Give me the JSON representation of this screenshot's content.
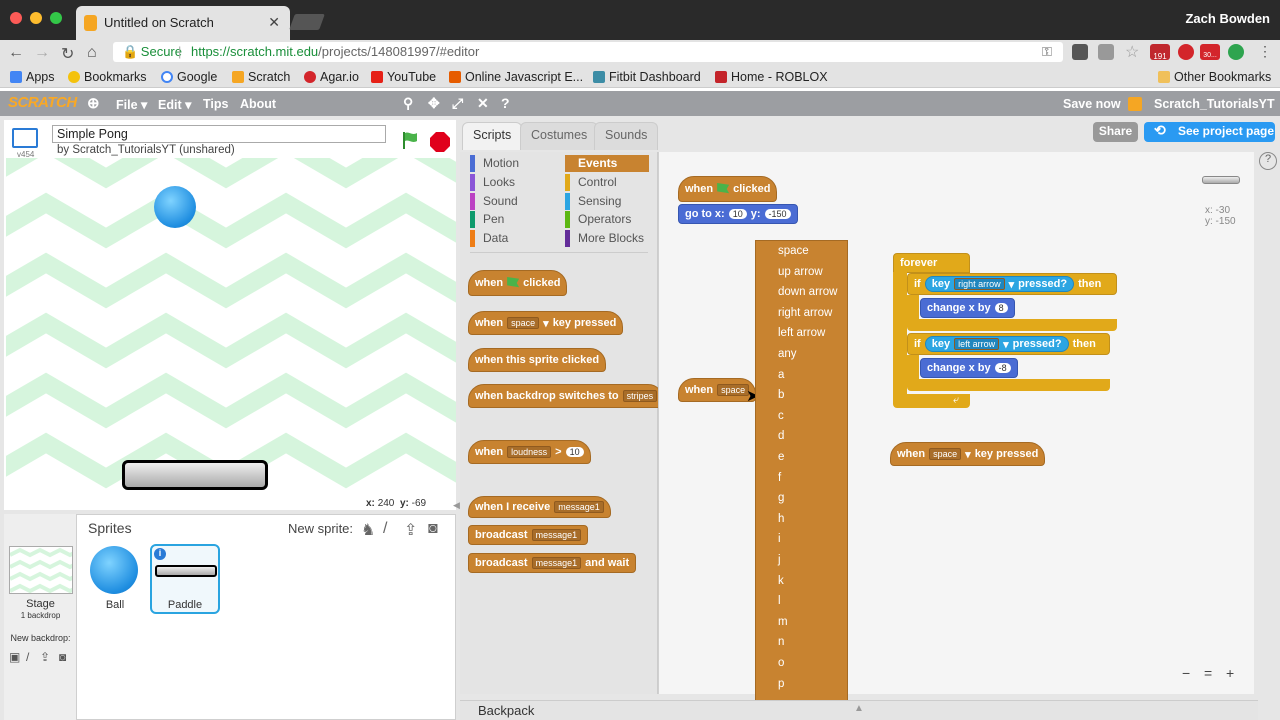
{
  "browser": {
    "tab_title": "Untitled on Scratch",
    "user": "Zach Bowden",
    "secure_label": "Secure",
    "url_host": "https://scratch.mit.edu",
    "url_path": "/projects/148081997/#editor",
    "bookmarks": [
      "Apps",
      "Bookmarks",
      "Google",
      "Scratch",
      "Agar.io",
      "YouTube",
      "Online Javascript E...",
      "Fitbit Dashboard",
      "Home - ROBLOX",
      "Other Bookmarks"
    ],
    "badge_count": "191",
    "badge_count2": "30..."
  },
  "menubar": {
    "logo": "SCRATCH",
    "file": "File ▾",
    "edit": "Edit ▾",
    "tips": "Tips",
    "about": "About",
    "save_now": "Save now",
    "account": "Scratch_TutorialsYT ▾"
  },
  "stage": {
    "version": "v454",
    "project_title": "Simple Pong",
    "by": "by Scratch_TutorialsYT (unshared)",
    "x_label": "x:",
    "x_value": "240",
    "y_label": "y:",
    "y_value": "-69"
  },
  "sprites": {
    "header": "Sprites",
    "new_sprite": "New sprite:",
    "stage_label": "Stage",
    "stage_sub": "1 backdrop",
    "new_backdrop": "New backdrop:",
    "items": [
      {
        "name": "Ball"
      },
      {
        "name": "Paddle"
      }
    ]
  },
  "tabs": {
    "scripts": "Scripts",
    "costumes": "Costumes",
    "sounds": "Sounds"
  },
  "categories": {
    "left": [
      "Motion",
      "Looks",
      "Sound",
      "Pen",
      "Data"
    ],
    "right": [
      "Events",
      "Control",
      "Sensing",
      "Operators",
      "More Blocks"
    ]
  },
  "palette": {
    "when_flag": "when",
    "clicked": "clicked",
    "when_key": "when",
    "key_space": "space",
    "key_pressed": "key pressed",
    "sprite_clicked": "when this sprite clicked",
    "backdrop_when": "when backdrop switches to",
    "backdrop_val": "stripes",
    "loud_when": "when",
    "loud_val": "loudness",
    "gt": ">",
    "loud_num": "10",
    "receive": "when I receive",
    "msg": "message1",
    "broadcast": "broadcast",
    "broadcast_wait": "broadcast",
    "and_wait": "and wait"
  },
  "scripts": {
    "hat1_when": "when",
    "hat1_clicked": "clicked",
    "goto": "go to x:",
    "goto_x": "10",
    "goto_y_label": "y:",
    "goto_y": "-150",
    "hat2_when": "when",
    "hat2_key": "space",
    "forever": "forever",
    "if1": "if",
    "key1": "key",
    "key1_val": "right arrow",
    "pressed1": "pressed?",
    "then1": "then",
    "change1": "change x by",
    "change1_val": "8",
    "if2": "if",
    "key2": "key",
    "key2_val": "left arrow",
    "pressed2": "pressed?",
    "then2": "then",
    "change2": "change x by",
    "change2_val": "-8",
    "hat3_when": "when",
    "hat3_key": "space",
    "hat3_pressed": "key pressed"
  },
  "dropdown_options": [
    "space",
    "up arrow",
    "down arrow",
    "right arrow",
    "left arrow",
    "any",
    "a",
    "b",
    "c",
    "d",
    "e",
    "f",
    "g",
    "h",
    "i",
    "j",
    "k",
    "l",
    "m",
    "n",
    "o",
    "p",
    "q"
  ],
  "top_right": {
    "share": "Share",
    "see_project": "See project page",
    "help": "?",
    "x_label": "x: -30",
    "y_label": "y: -150"
  },
  "backpack": "Backpack",
  "zoom": {
    "out": "−",
    "reset": "=",
    "in": "+"
  }
}
